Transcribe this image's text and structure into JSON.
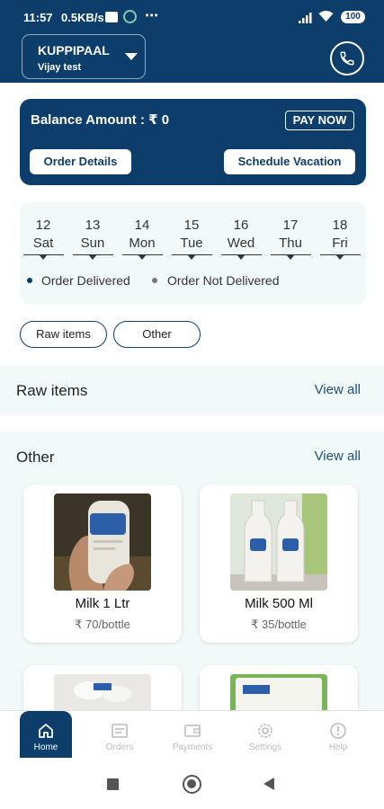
{
  "status_bar": {
    "time": "11:57",
    "speed": "0.5KB/s",
    "dots": "⋯",
    "battery": "100"
  },
  "header": {
    "store_name": "KUPPIPAAL",
    "store_sub": "Vijay test",
    "call_icon": "phone-icon"
  },
  "balance": {
    "text": "Balance Amount : ₹ 0",
    "pay_now": "PAY NOW",
    "order_details": "Order Details",
    "schedule_vacation": "Schedule Vacation"
  },
  "dates": [
    {
      "num": "12",
      "day": "Sat"
    },
    {
      "num": "13",
      "day": "Sun"
    },
    {
      "num": "14",
      "day": "Mon"
    },
    {
      "num": "15",
      "day": "Tue"
    },
    {
      "num": "16",
      "day": "Wed"
    },
    {
      "num": "17",
      "day": "Thu"
    },
    {
      "num": "18",
      "day": "Fri"
    }
  ],
  "legend": {
    "delivered": "Order Delivered",
    "not_delivered": "Order Not Delivered",
    "delivered_color": "#0d3d6b",
    "not_delivered_color": "#777777"
  },
  "chips": [
    "Raw items",
    "Other"
  ],
  "sections": {
    "raw": {
      "title": "Raw items",
      "view_all": "View all"
    },
    "other": {
      "title": "Other",
      "view_all": "View all"
    }
  },
  "products": [
    {
      "name": "Milk 1 Ltr",
      "price": "₹ 70/bottle"
    },
    {
      "name": "Milk 500 Ml",
      "price": "₹ 35/bottle"
    }
  ],
  "bottom_nav": [
    {
      "label": "Home",
      "icon": "home-icon",
      "active": true
    },
    {
      "label": "Orders",
      "icon": "orders-icon",
      "active": false
    },
    {
      "label": "Payments",
      "icon": "payments-icon",
      "active": false
    },
    {
      "label": "Settings",
      "icon": "settings-icon",
      "active": false
    },
    {
      "label": "Help",
      "icon": "help-icon",
      "active": false
    }
  ],
  "colors": {
    "primary": "#0d3d6b",
    "panel": "#f2f9f9"
  }
}
